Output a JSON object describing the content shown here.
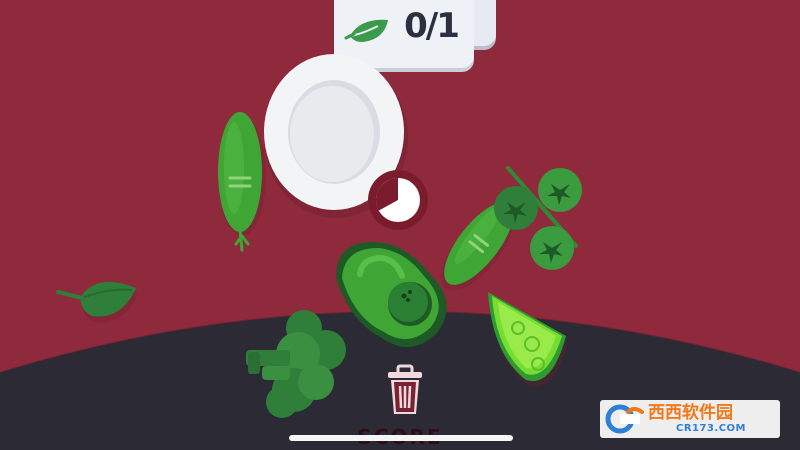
{
  "game": {
    "ingredient_counter": "0/1",
    "counter_icon": "leaf-icon",
    "score_label": "SCORE",
    "timer_progress": 0.33
  },
  "colors": {
    "background": "#8f2a3c",
    "bottom_arc": "#2b2a35",
    "vegetable_green": "#3fa535",
    "lime_green": "#6ed52e",
    "plate_white": "#f3f4f6"
  },
  "watermark": {
    "brand": "西西软件园",
    "url": "CR173.COM"
  }
}
